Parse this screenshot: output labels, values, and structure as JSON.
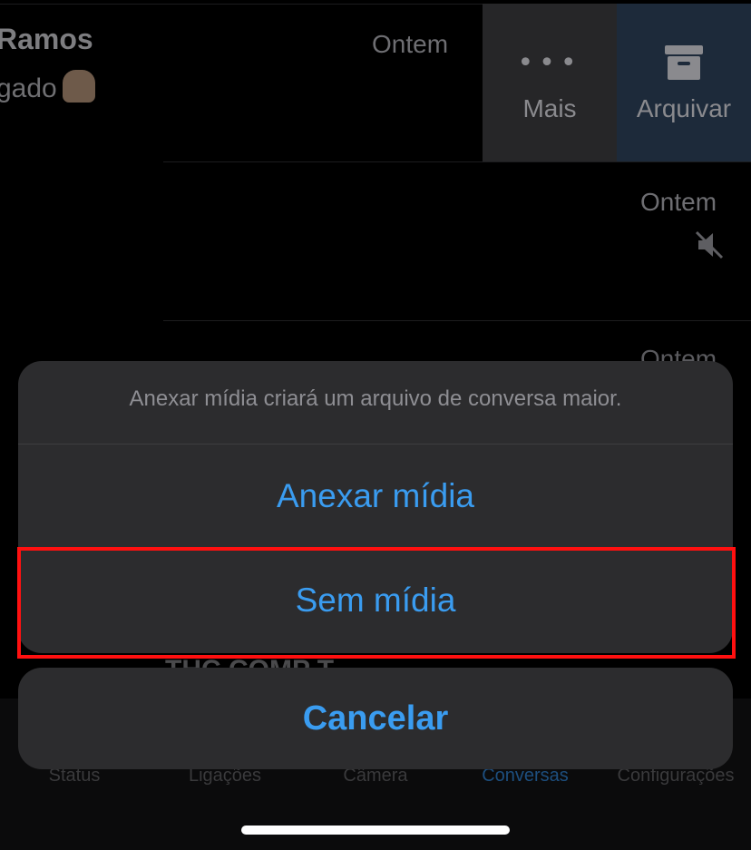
{
  "chat_list": {
    "rows": [
      {
        "name": "Ramos",
        "message": "gado",
        "time": "Ontem",
        "actions": {
          "more_label": "Mais",
          "archive_label": "Arquivar"
        }
      },
      {
        "time": "Ontem",
        "muted": true
      },
      {
        "time": "Ontem"
      }
    ],
    "peek_text": "THC COMP T"
  },
  "tabbar": {
    "tabs": [
      {
        "label": "Status"
      },
      {
        "label": "Ligações"
      },
      {
        "label": "Câmera"
      },
      {
        "label": "Conversas",
        "active": true
      },
      {
        "label": "Configurações"
      }
    ]
  },
  "action_sheet": {
    "message": "Anexar mídia criará um arquivo de conversa maior.",
    "attach_label": "Anexar mídia",
    "no_media_label": "Sem mídia",
    "cancel_label": "Cancelar"
  },
  "colors": {
    "accent": "#3a9cf0",
    "highlight": "#ff1010",
    "sheet_bg": "#2c2c2e"
  }
}
